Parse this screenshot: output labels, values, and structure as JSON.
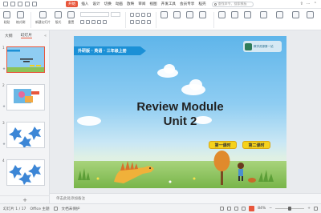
{
  "menubar": {
    "tabs": [
      "开始",
      "插入",
      "设计",
      "切换",
      "动画",
      "放映",
      "审阅",
      "视图",
      "开发工具",
      "会员专享",
      "稻壳"
    ],
    "active_tab": "开始",
    "search_placeholder": "查找命令、搜索模板",
    "accent_color": "#e8563c"
  },
  "toolbar": {
    "groups": [
      "粘贴",
      "格式刷",
      "新建幻灯片",
      "版式",
      "重置"
    ]
  },
  "left_panel": {
    "tabs": [
      "大纲",
      "幻灯片"
    ],
    "active_tab": "幻灯片",
    "slides": [
      {
        "num": "1"
      },
      {
        "num": "2"
      },
      {
        "num": "3"
      },
      {
        "num": "4"
      }
    ],
    "add_label": "+"
  },
  "slide": {
    "banner": "外研版 · 英语 · 三年级上册",
    "title": "Review Module",
    "subtitle": "Unit 2",
    "btn_lesson1": "第一课时",
    "btn_lesson2": "第二课时",
    "logo_text": "教学资源第一站"
  },
  "notes": {
    "placeholder": "单击此处添加备注"
  },
  "status": {
    "slide_count": "幻灯片 1 / 17",
    "theme": "Office 主题",
    "zoom": "84%",
    "protect": "文档未保护"
  }
}
